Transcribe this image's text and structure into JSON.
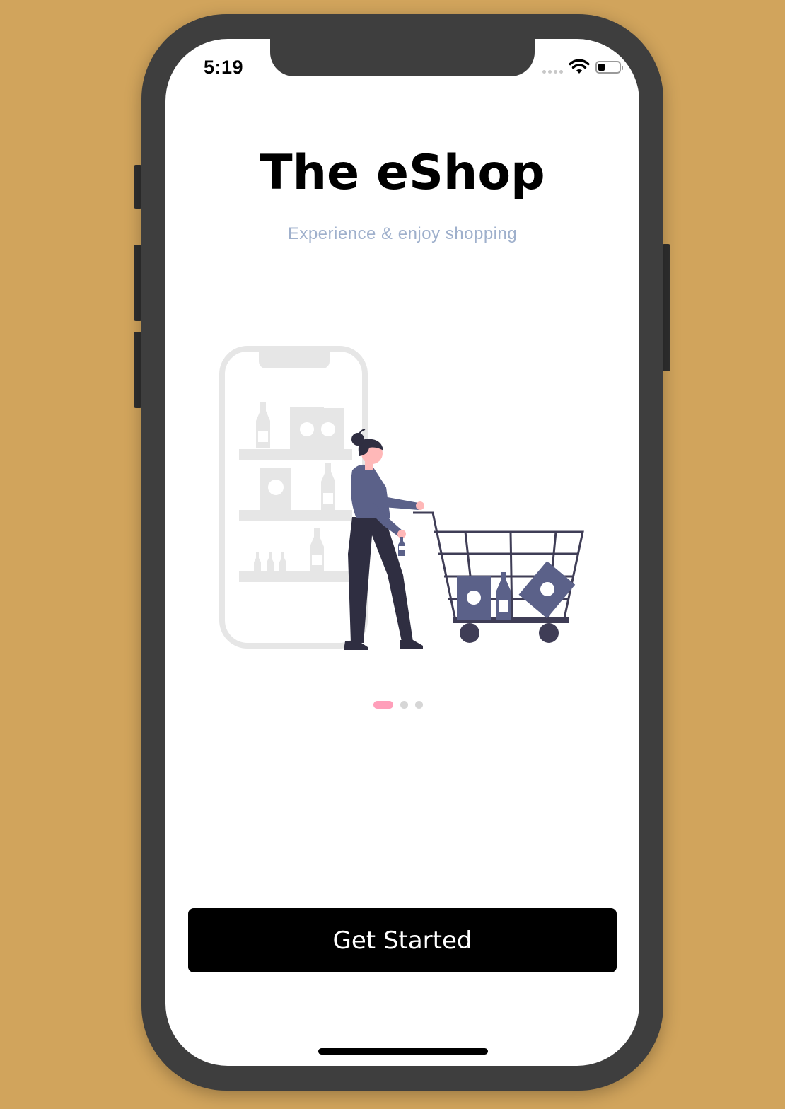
{
  "status_bar": {
    "time": "5:19",
    "icons": [
      "signal-dots-icon",
      "wifi-icon",
      "battery-icon"
    ]
  },
  "onboarding": {
    "title": "The eShop",
    "subtitle": "Experience & enjoy shopping",
    "illustration": "woman-shopping-cart-illustration",
    "page_count": 3,
    "active_page": 1
  },
  "actions": {
    "get_started_label": "Get Started"
  },
  "colors": {
    "background": "#D1A45C",
    "phone_frame": "#3e3e3e",
    "subtitle": "#9fb0cc",
    "pager_active": "#ff9fba",
    "pager_inactive": "#d6d6d6",
    "button": "#000000",
    "figure_accent": "#5b6189"
  }
}
